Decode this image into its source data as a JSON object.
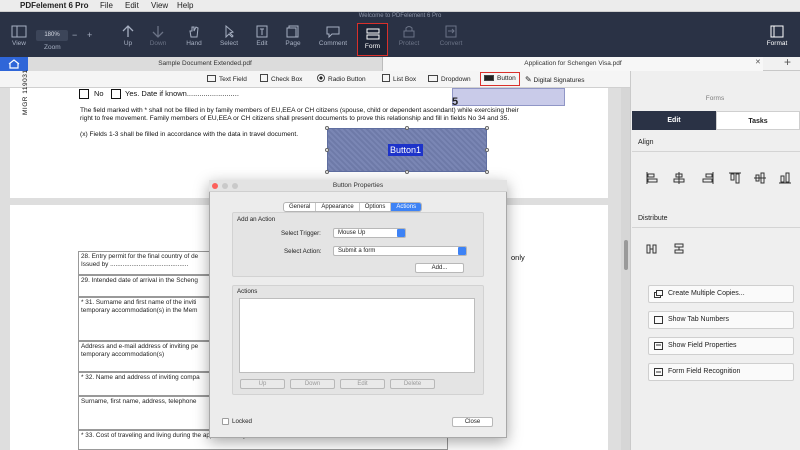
{
  "menubar": {
    "app": "PDFelement 6 Pro",
    "items": [
      "File",
      "Edit",
      "View",
      "Help"
    ]
  },
  "toolbar": {
    "window_title": "Welcome to PDFelement 6 Pro",
    "zoom": "180%",
    "items": {
      "view": "View",
      "zoom": "Zoom",
      "up": "Up",
      "down": "Down",
      "hand": "Hand",
      "select": "Select",
      "edit": "Edit",
      "page": "Page",
      "comment": "Comment",
      "form": "Form",
      "protect": "Protect",
      "convert": "Convert",
      "format": "Format"
    }
  },
  "tabs": {
    "doc1": "Sample Document Extended.pdf",
    "doc2": "Application for Schengen Visa.pdf",
    "close": "✕",
    "add": "+"
  },
  "formbar": {
    "text_field": "Text Field",
    "check_box": "Check Box",
    "radio_button": "Radio Button",
    "list_box": "List Box",
    "dropdown": "Dropdown",
    "button": "Button",
    "digital_signatures": "Digital Signatures"
  },
  "document": {
    "side_code": "MIGR 119031",
    "no": "No",
    "yes": "Yes. Date if known.........................",
    "note1": "The field marked with * shall not be filled in by family members of EU,EEA or CH citizens (spouse, child or dependent ascendant) while exercising their",
    "note2": "right to free movement. Family members of EU,EEA or CH citizens shall present documents to prove this relationship and fill in fields No 34 and 35.",
    "note3": "(x)  Fields 1-3 shall be filled in accordance with the data in travel document.",
    "button_label": "Button1",
    "row28a": "28. Entry permit for the final country of de",
    "row28b": "Issued by ............................................",
    "row28c": "only",
    "row29": "29. Intended date of arrival in the Scheng",
    "row31a": "* 31. Surname and first name of the inviti",
    "row31b": "temporary accommodation(s) in the Mem",
    "row_addr_a": "Address and e-mail address of inviting pe",
    "row_addr_b": "temporary accommodation(s)",
    "row32": "* 32. Name and address of inviting compa",
    "row_surname": "Surname, first name, address, telephone",
    "row33": "* 33. Cost of traveling and living during the applicant's stay is covered"
  },
  "panel": {
    "header": "Forms",
    "tab_edit": "Edit",
    "tab_tasks": "Tasks",
    "align": "Align",
    "distribute": "Distribute",
    "buttons": [
      "Create Multiple Copies...",
      "Show Tab Numbers",
      "Show Field Properties",
      "Form Field Recognition"
    ]
  },
  "dialog": {
    "title": "Button Properties",
    "tabs": [
      "General",
      "Appearance",
      "Options",
      "Actions"
    ],
    "active_tab": "Actions",
    "add_action": "Add an Action",
    "select_trigger_label": "Select Trigger:",
    "select_trigger_value": "Mouse Up",
    "select_action_label": "Select Action:",
    "select_action_value": "Submit a form",
    "add_button": "Add...",
    "actions_label": "Actions",
    "up": "Up",
    "down": "Down",
    "edit": "Edit",
    "delete": "Delete",
    "locked": "Locked",
    "close": "Close"
  },
  "colors": {
    "toolbar_bg": "#2a3245",
    "accent_blue": "#3d82f5",
    "highlight_red": "#d9302b"
  }
}
